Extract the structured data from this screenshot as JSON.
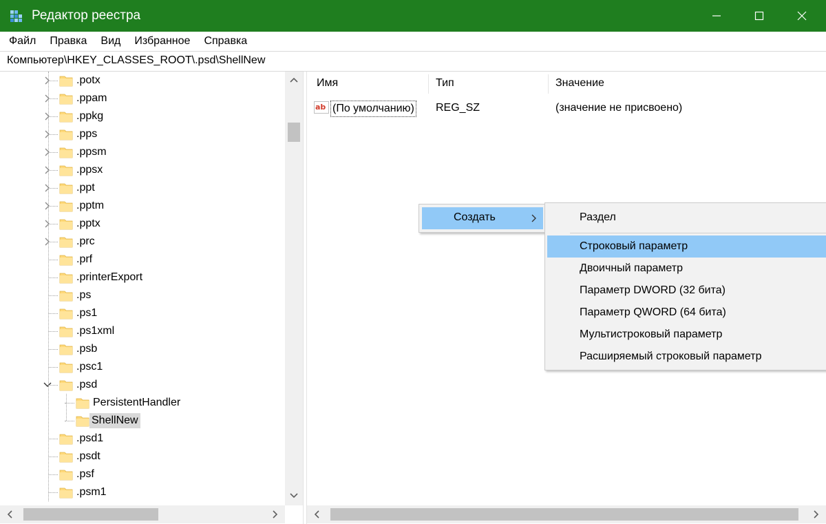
{
  "window": {
    "title": "Редактор реестра",
    "accent_color": "#1f7e1f"
  },
  "menu": [
    "Файл",
    "Правка",
    "Вид",
    "Избранное",
    "Справка"
  ],
  "address": "Компьютер\\HKEY_CLASSES_ROOT\\.psd\\ShellNew",
  "tree": {
    "items": [
      {
        "label": ".potx",
        "expandable": true
      },
      {
        "label": ".ppam",
        "expandable": true
      },
      {
        "label": ".ppkg",
        "expandable": true
      },
      {
        "label": ".pps",
        "expandable": true
      },
      {
        "label": ".ppsm",
        "expandable": true
      },
      {
        "label": ".ppsx",
        "expandable": true
      },
      {
        "label": ".ppt",
        "expandable": true
      },
      {
        "label": ".pptm",
        "expandable": true
      },
      {
        "label": ".pptx",
        "expandable": true
      },
      {
        "label": ".prc",
        "expandable": true
      },
      {
        "label": ".prf",
        "expandable": false
      },
      {
        "label": ".printerExport",
        "expandable": false
      },
      {
        "label": ".ps",
        "expandable": false
      },
      {
        "label": ".ps1",
        "expandable": false
      },
      {
        "label": ".ps1xml",
        "expandable": false
      },
      {
        "label": ".psb",
        "expandable": false
      },
      {
        "label": ".psc1",
        "expandable": false
      },
      {
        "label": ".psd",
        "expandable": true,
        "expanded": true
      },
      {
        "label": "PersistentHandler",
        "expandable": false,
        "child": true
      },
      {
        "label": "ShellNew",
        "expandable": false,
        "child": true,
        "selected": true
      },
      {
        "label": ".psd1",
        "expandable": false
      },
      {
        "label": ".psdt",
        "expandable": false
      },
      {
        "label": ".psf",
        "expandable": false
      },
      {
        "label": ".psm1",
        "expandable": false
      }
    ]
  },
  "list": {
    "columns": {
      "name": "Имя",
      "type": "Тип",
      "value": "Значение"
    },
    "rows": [
      {
        "name": "(По умолчанию)",
        "type": "REG_SZ",
        "value": "(значение не присвоено)",
        "icon": "string-value-icon"
      }
    ]
  },
  "context_menu": {
    "create_label": "Создать",
    "submenu": [
      "Раздел",
      "Строковый параметр",
      "Двоичный параметр",
      "Параметр DWORD (32 бита)",
      "Параметр QWORD (64 бита)",
      "Мультистроковый параметр",
      "Расширяемый строковый параметр"
    ],
    "highlighted": "Строковый параметр",
    "highlight_color": "#91c9f7"
  }
}
